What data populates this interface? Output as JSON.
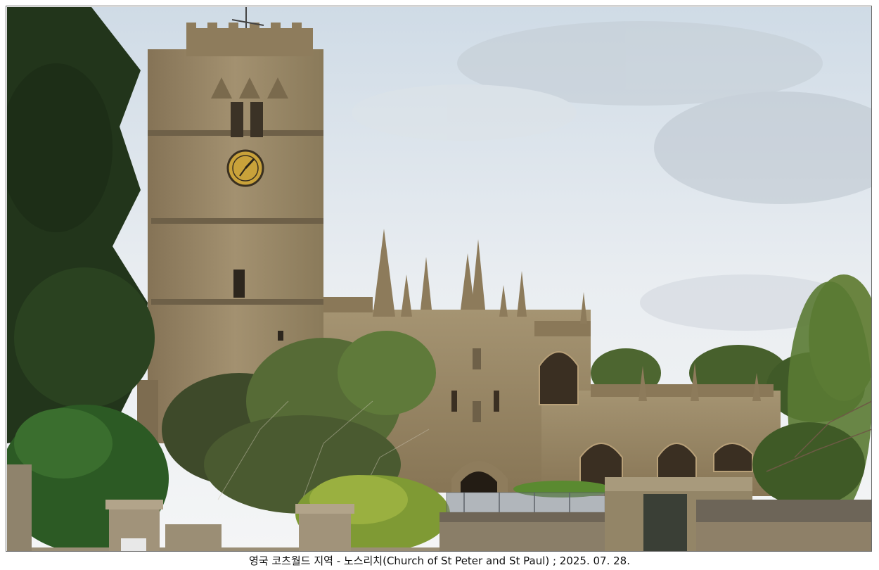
{
  "caption": "영국 코츠월드 지역 - 노스리치(Church of St Peter and St Paul) ; 2025. 07. 28.",
  "clock_label": "clock",
  "colors": {
    "sky_top": "#d9e4ee",
    "sky_bottom": "#f2f4f6",
    "stone": "#9c8b68",
    "stone_dark": "#6e6048",
    "foliage": "#2f4a22",
    "foliage_light": "#8da83a",
    "clock_face": "#c9a23a"
  }
}
